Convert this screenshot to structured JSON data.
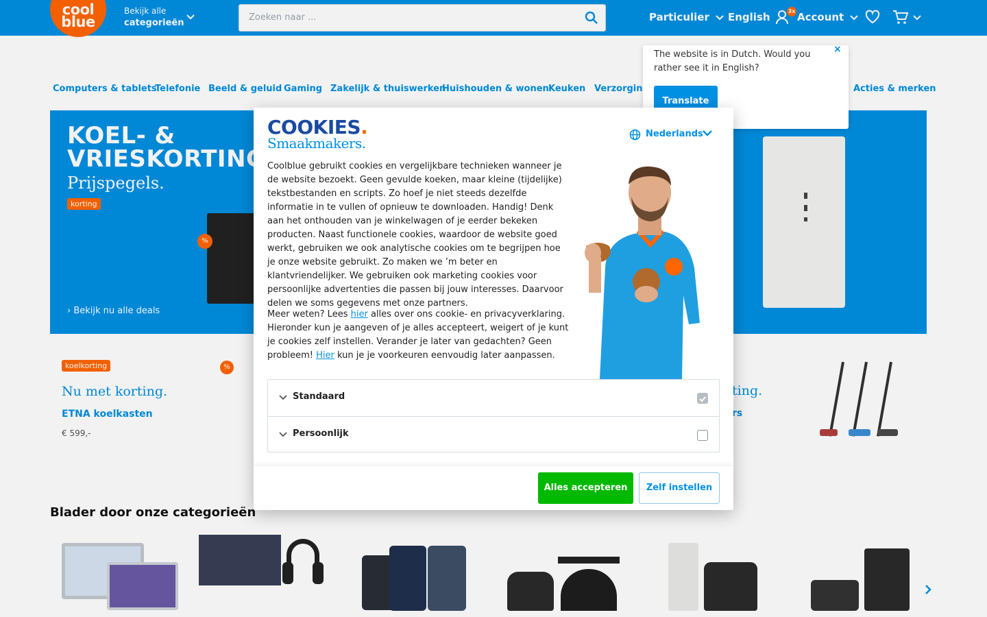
{
  "colors": {
    "brand_blue": "#0090e3",
    "brand_orange": "#ff6600",
    "accept_green": "#00b900"
  },
  "header": {
    "logo_line1": "cool",
    "logo_line2": "blue",
    "categories_small": "Bekijk alle",
    "categories_big": "categorieën",
    "search_placeholder": "Zoeken naar ...",
    "nav_private": "Particulier",
    "nav_language": "English",
    "nav_account": "Account",
    "account_badge": "3x"
  },
  "subnav": {
    "items": [
      "Computers & tablets",
      "Telefonie",
      "Beeld & geluid",
      "Gaming",
      "Zakelijk & thuiswerken",
      "Huishouden & wonen",
      "Keuken",
      "Verzorging",
      "Acties & merken"
    ]
  },
  "hero": {
    "title_line1": "KOEL- &",
    "title_line2": "VRIESKORTING",
    "title_dot": ".",
    "subtitle": "Prijspegels.",
    "tag": "korting",
    "fridge_badge": "%",
    "link": "Bekijk nu alle deals"
  },
  "promo": {
    "tag": "koelkorting",
    "pct": "%",
    "headline": "Nu met korting.",
    "title": "ETNA koelkasten",
    "price": "€ 599,-",
    "headline2": "ting.",
    "title2": "rs"
  },
  "categories": {
    "heading": "Blader door onze categorieën"
  },
  "translate_popup": {
    "text": "The website is in Dutch. Would you rather see it in English?",
    "close": "×",
    "button": "Translate"
  },
  "cookie_modal": {
    "logo_title": "COOKIES",
    "logo_dot": ".",
    "logo_sub": "Smaakmakers.",
    "language": "Nederlands",
    "body_paragraph": "Coolblue gebruikt cookies en vergelijkbare technieken wanneer je de website bezoekt. Geen gevulde koeken, maar kleine (tijdelijke) tekstbestanden en scripts. Zo hoef je niet steeds dezelfde informatie in te vullen of opnieuw te downloaden. Handig! Denk aan het onthouden van je winkelwagen of je eerder bekeken producten. Naast functionele cookies, waardoor de website goed werkt, gebruiken we ook analytische cookies om te begrijpen hoe je onze website gebruikt. Zo maken we ’m beter en klantvriendelijker. We gebruiken ook marketing cookies voor persoonlijke advertenties die passen bij jouw interesses. Daarvoor delen we soms gegevens met onze partners.",
    "more_prefix": "Meer weten? Lees ",
    "more_link": "hier",
    "more_suffix": " alles over ons cookie- en privacyverklaring. Hieronder kun je aangeven of je alles accepteert, weigert of je kunt je cookies zelf instellen. Verander je later van gedachten? Geen probleem! ",
    "later_link": "Hier",
    "later_suffix": " kun je je voorkeuren eenvoudig later aanpassen.",
    "options": [
      {
        "label": "Standaard",
        "checked": true
      },
      {
        "label": "Persoonlijk",
        "checked": false
      }
    ],
    "accept_button": "Alles accepteren",
    "configure_button": "Zelf instellen"
  }
}
